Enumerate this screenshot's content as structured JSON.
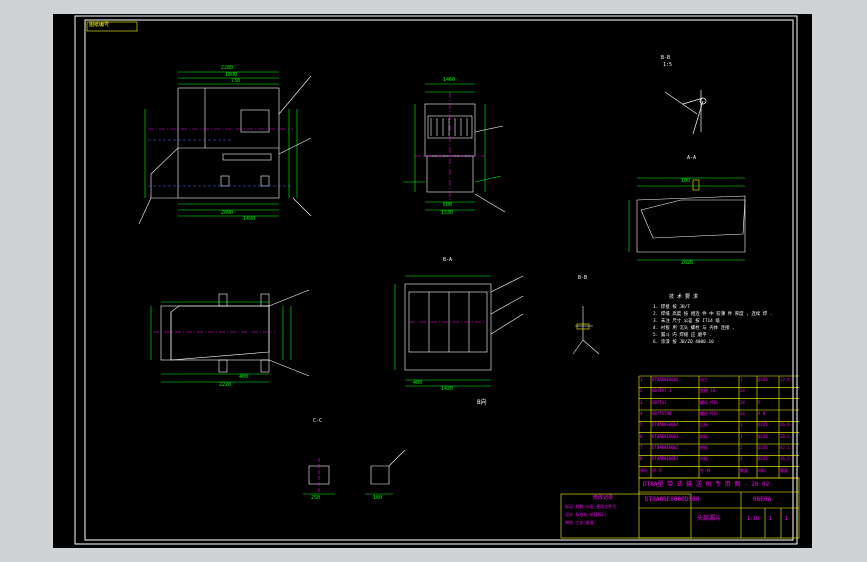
{
  "colors": {
    "background": "#000000",
    "frame": "#ffffff",
    "dimension": "#00ff00",
    "outline": "#ffffff",
    "centerline": "#ff00ff",
    "hidden": "#4f6bff",
    "title_block": "#ffff00",
    "table_text": "#ff00ff",
    "leader": "#ffffff"
  },
  "drawing": {
    "stamp_label": "图纸编号",
    "title_line": "DT8A型  带 式 输 送 机 专 用 图 - 20 02",
    "drawing_number": "DT8A08E0000D000",
    "revision_mark": "08E0A",
    "part_name": "头部漏斗",
    "section_labels": [
      "B-B",
      "A-A",
      "B-A",
      "B-B",
      "C-C"
    ],
    "view_label": "B向",
    "notes_title": "技 术 要 求",
    "notes": [
      "1. 焊接 按 JB/T",
      "2. 焊缝 高度 按 相连 件 中 较薄 件 厚度 , 连续 焊 .",
      "3. 未注 尺寸 公差 按 IT14 级 .",
      "4. 衬板 用 沉头 螺栓 与 壳体 连接 .",
      "5. 漏斗 内 焊缝 应 磨平 .",
      "6. 涂漆 按 JB/ZQ 4000.10"
    ]
  },
  "dims": {
    "top_width": "2280",
    "span": "1800",
    "h1": "730",
    "front_total": "2090",
    "front_sub": "1490",
    "side_top": "1460",
    "side_bottom": "1530",
    "side_mid": "600",
    "plan_length": "2220",
    "plan_offset": "400",
    "grid_width": "1420",
    "grid_step": "400",
    "section_length": "2020",
    "section_height": "100",
    "small_a": "250",
    "small_b": "160",
    "detail_scale": "1:5"
  },
  "parts_table": [
    {
      "no": "8",
      "code": "DT8A08E0001",
      "name": "衬板",
      "qty": "4",
      "mat": "Q235",
      "note": "16.3"
    },
    {
      "no": "7",
      "code": "DT8A08E0002",
      "name": "侧板",
      "qty": "2",
      "mat": "Q235",
      "note": "42.1"
    },
    {
      "no": "6",
      "code": "DT8A08E0003",
      "name": "前板",
      "qty": "1",
      "mat": "Q235",
      "note": "28.5"
    },
    {
      "no": "5",
      "code": "DT8A08E0004",
      "name": "后板",
      "qty": "1",
      "mat": "Q235",
      "note": "26.0"
    },
    {
      "no": "4",
      "code": "GB/T5780",
      "name": "螺栓 M16",
      "qty": "24",
      "mat": "4.8",
      "note": ""
    },
    {
      "no": "3",
      "code": "GB/T41",
      "name": "螺母 M16",
      "qty": "24",
      "mat": "5",
      "note": ""
    },
    {
      "no": "2",
      "code": "GB/T97.1",
      "name": "垫圈 16",
      "qty": "24",
      "mat": "",
      "note": ""
    },
    {
      "no": "1",
      "code": "DT8A08E0005",
      "name": "法兰",
      "qty": "1",
      "mat": "Q235",
      "note": "12.4"
    }
  ],
  "table_header": {
    "no": "序号",
    "code": "代 号",
    "name": "名 称",
    "qty": "数量",
    "mat": "材料",
    "note": "重量"
  },
  "revision_block": {
    "heading": "修改记录",
    "rows": [
      "标记 处数 分区 更改文件号",
      "设计 标准化 阶段标记",
      "审核 工艺 批准"
    ]
  },
  "sheet_info": {
    "scale": "1:10",
    "sheet": "1",
    "sheets": "1"
  }
}
